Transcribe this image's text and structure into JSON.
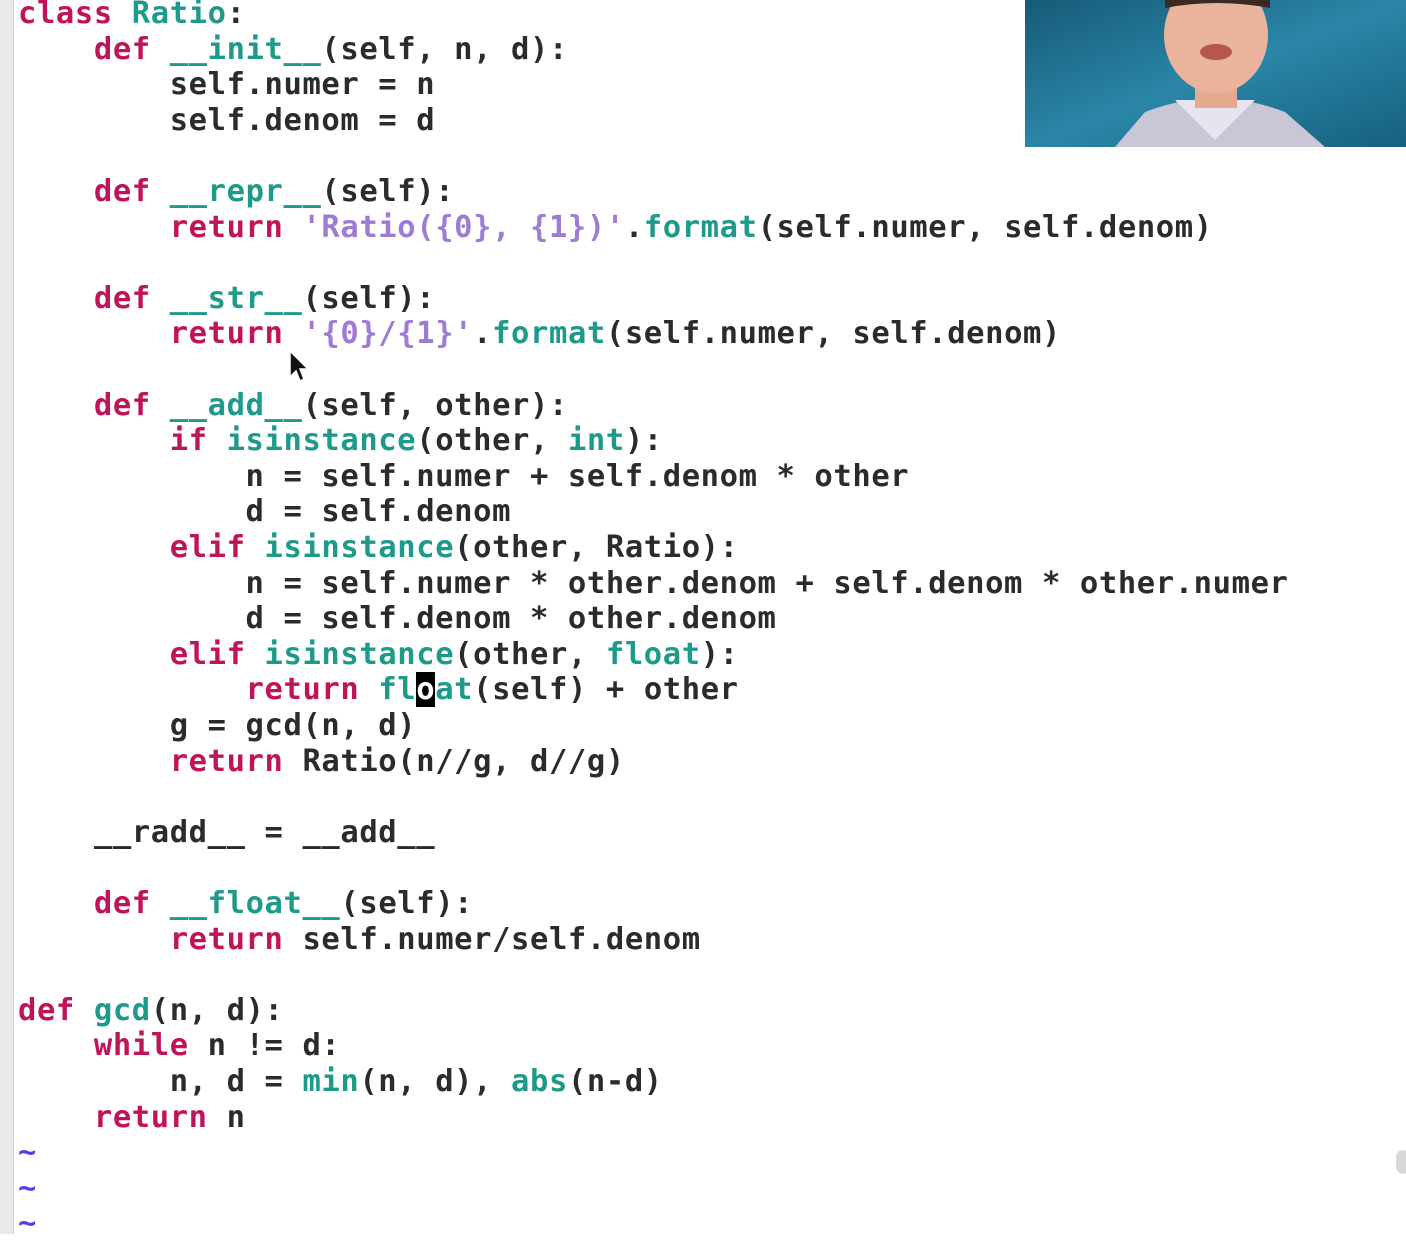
{
  "editor": {
    "lines": [
      [
        {
          "t": "class ",
          "c": "kw"
        },
        {
          "t": "Ratio",
          "c": "bi"
        },
        {
          "t": ":",
          "c": "tok"
        }
      ],
      [
        {
          "t": "    "
        },
        {
          "t": "def ",
          "c": "kw"
        },
        {
          "t": "__init__",
          "c": "bi"
        },
        {
          "t": "(self, n, d):",
          "c": "tok"
        }
      ],
      [
        {
          "t": "        self.numer = n",
          "c": "tok"
        }
      ],
      [
        {
          "t": "        self.denom = d",
          "c": "tok"
        }
      ],
      [],
      [
        {
          "t": "    "
        },
        {
          "t": "def ",
          "c": "kw"
        },
        {
          "t": "__repr__",
          "c": "bi"
        },
        {
          "t": "(self):",
          "c": "tok"
        }
      ],
      [
        {
          "t": "        "
        },
        {
          "t": "return ",
          "c": "kw"
        },
        {
          "t": "'Ratio({0}, {1})'",
          "c": "str"
        },
        {
          "t": ".",
          "c": "tok"
        },
        {
          "t": "format",
          "c": "bi"
        },
        {
          "t": "(self.numer, self.denom)",
          "c": "tok"
        }
      ],
      [],
      [
        {
          "t": "    "
        },
        {
          "t": "def ",
          "c": "kw"
        },
        {
          "t": "__str__",
          "c": "bi"
        },
        {
          "t": "(self):",
          "c": "tok"
        }
      ],
      [
        {
          "t": "        "
        },
        {
          "t": "return ",
          "c": "kw"
        },
        {
          "t": "'{0}/{1}'",
          "c": "str"
        },
        {
          "t": ".",
          "c": "tok"
        },
        {
          "t": "format",
          "c": "bi"
        },
        {
          "t": "(self.numer, self.denom)",
          "c": "tok"
        }
      ],
      [],
      [
        {
          "t": "    "
        },
        {
          "t": "def ",
          "c": "kw"
        },
        {
          "t": "__add__",
          "c": "bi"
        },
        {
          "t": "(self, other):",
          "c": "tok"
        }
      ],
      [
        {
          "t": "        "
        },
        {
          "t": "if ",
          "c": "kw"
        },
        {
          "t": "isinstance",
          "c": "bi"
        },
        {
          "t": "(other, ",
          "c": "tok"
        },
        {
          "t": "int",
          "c": "bi"
        },
        {
          "t": "):",
          "c": "tok"
        }
      ],
      [
        {
          "t": "            n = self.numer + self.denom * other",
          "c": "tok"
        }
      ],
      [
        {
          "t": "            d = self.denom",
          "c": "tok"
        }
      ],
      [
        {
          "t": "        "
        },
        {
          "t": "elif ",
          "c": "kw"
        },
        {
          "t": "isinstance",
          "c": "bi"
        },
        {
          "t": "(other, Ratio):",
          "c": "tok"
        }
      ],
      [
        {
          "t": "            n = self.numer * other.denom + self.denom * other.numer",
          "c": "tok"
        }
      ],
      [
        {
          "t": "            d = self.denom * other.denom",
          "c": "tok"
        }
      ],
      [
        {
          "t": "        "
        },
        {
          "t": "elif ",
          "c": "kw"
        },
        {
          "t": "isinstance",
          "c": "bi"
        },
        {
          "t": "(other, ",
          "c": "tok"
        },
        {
          "t": "float",
          "c": "bi"
        },
        {
          "t": "):",
          "c": "tok"
        }
      ],
      [
        {
          "t": "            "
        },
        {
          "t": "return ",
          "c": "kw"
        },
        {
          "t": "fl",
          "c": "bi"
        },
        {
          "t": "o",
          "c": "cursor"
        },
        {
          "t": "at",
          "c": "bi"
        },
        {
          "t": "(self) + other",
          "c": "tok"
        }
      ],
      [
        {
          "t": "        g = gcd(n, d)",
          "c": "tok"
        }
      ],
      [
        {
          "t": "        "
        },
        {
          "t": "return ",
          "c": "kw"
        },
        {
          "t": "Ratio(n//g, d//g)",
          "c": "tok"
        }
      ],
      [],
      [
        {
          "t": "    __radd__ = __add__",
          "c": "tok"
        }
      ],
      [],
      [
        {
          "t": "    "
        },
        {
          "t": "def ",
          "c": "kw"
        },
        {
          "t": "__float__",
          "c": "bi"
        },
        {
          "t": "(self):",
          "c": "tok"
        }
      ],
      [
        {
          "t": "        "
        },
        {
          "t": "return ",
          "c": "kw"
        },
        {
          "t": "self.numer/self.denom",
          "c": "tok"
        }
      ],
      [],
      [
        {
          "t": "def ",
          "c": "kw"
        },
        {
          "t": "gcd",
          "c": "bi"
        },
        {
          "t": "(n, d):",
          "c": "tok"
        }
      ],
      [
        {
          "t": "    "
        },
        {
          "t": "while ",
          "c": "kw"
        },
        {
          "t": "n != d:",
          "c": "tok"
        }
      ],
      [
        {
          "t": "        n, d = ",
          "c": "tok"
        },
        {
          "t": "min",
          "c": "bi"
        },
        {
          "t": "(n, d), ",
          "c": "tok"
        },
        {
          "t": "abs",
          "c": "bi"
        },
        {
          "t": "(n-d)",
          "c": "tok"
        }
      ],
      [
        {
          "t": "    "
        },
        {
          "t": "return ",
          "c": "kw"
        },
        {
          "t": "n",
          "c": "tok"
        }
      ],
      [
        {
          "t": "~",
          "c": "tilde"
        }
      ],
      [
        {
          "t": "~",
          "c": "tilde"
        }
      ],
      [
        {
          "t": "~",
          "c": "tilde"
        }
      ]
    ]
  },
  "colors": {
    "keyword": "#c0145a",
    "builtin": "#1e9a8a",
    "string": "#9e7bd4",
    "text": "#2b2b2b",
    "tilde": "#5a3bf0"
  },
  "overlays": {
    "webcam_icon": "presenter-webcam",
    "pointer_icon": "mouse-pointer-icon"
  }
}
